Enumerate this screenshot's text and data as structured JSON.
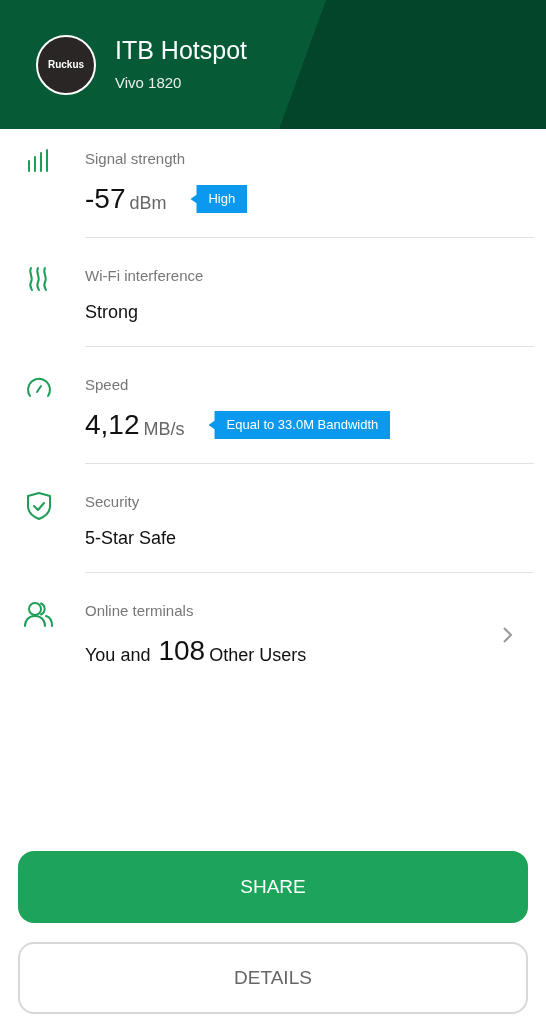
{
  "header": {
    "logo_text": "Ruckus",
    "title": "ITB Hotspot",
    "subtitle": "Vivo 1820"
  },
  "rows": [
    {
      "kind": "signal",
      "label": "Signal strength",
      "value": "-57",
      "unit": "dBm",
      "badge": "High"
    },
    {
      "kind": "interference",
      "label": "Wi-Fi interference",
      "value": "Strong"
    },
    {
      "kind": "speed",
      "label": "Speed",
      "value": "4,12",
      "unit": "MB/s",
      "badge": "Equal to 33.0M Bandwidth"
    },
    {
      "kind": "security",
      "label": "Security",
      "value": "5-Star Safe"
    },
    {
      "kind": "terminals",
      "label": "Online terminals",
      "prefix": "You and",
      "value": "108",
      "unit": "Other Users",
      "chevron": true
    }
  ],
  "buttons": [
    {
      "kind": "primary",
      "label": "SHARE"
    },
    {
      "kind": "secondary",
      "label": "DETAILS"
    }
  ]
}
